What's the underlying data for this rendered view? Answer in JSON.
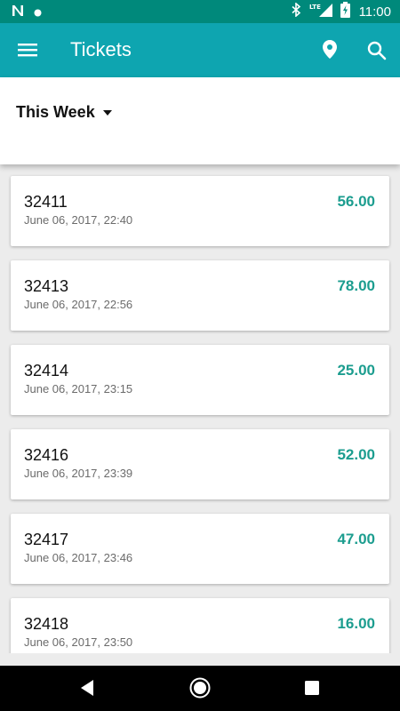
{
  "status_bar": {
    "time": "11:00",
    "icons": [
      "n-icon",
      "dot-icon",
      "bluetooth-icon",
      "lte-icon",
      "signal-icon",
      "battery-icon"
    ],
    "lte_label": "LTE"
  },
  "app_bar": {
    "title": "Tickets",
    "background": "#0ea5b0",
    "icons": [
      "menu-icon",
      "location-pin-icon",
      "search-icon"
    ]
  },
  "filter": {
    "selected": "This Week",
    "icon": "caret-down-icon"
  },
  "tickets": [
    {
      "id": "32411",
      "date": "June 06, 2017, 22:40",
      "amount": "56.00"
    },
    {
      "id": "32413",
      "date": "June 06, 2017, 22:56",
      "amount": "78.00"
    },
    {
      "id": "32414",
      "date": "June 06, 2017, 23:15",
      "amount": "25.00"
    },
    {
      "id": "32416",
      "date": "June 06, 2017, 23:39",
      "amount": "52.00"
    },
    {
      "id": "32417",
      "date": "June 06, 2017, 23:46",
      "amount": "47.00"
    },
    {
      "id": "32418",
      "date": "June 06, 2017, 23:50",
      "amount": "16.00"
    }
  ],
  "colors": {
    "status_bar": "#00897b",
    "amount_text": "#1c9d8f"
  },
  "nav_bar": {
    "icons": [
      "back-icon",
      "home-icon",
      "recent-apps-icon"
    ]
  }
}
